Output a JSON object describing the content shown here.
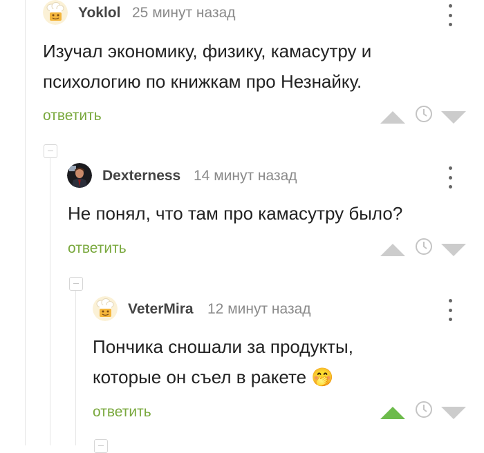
{
  "comments": [
    {
      "author": "Yoklol",
      "time": "25 минут назад",
      "text_lines": [
        "Изучал экономику, физику, камасутру и",
        "психологию по книжкам про Незнайку."
      ],
      "reply_label": "ответить"
    },
    {
      "author": "Dexterness",
      "time": "14 минут назад",
      "text_lines": [
        "Не понял, что там про камасутру было?"
      ],
      "reply_label": "ответить"
    },
    {
      "author": "VeterMira",
      "time": "12 минут назад",
      "text_lines": [
        "Пончика сношали за продукты,",
        "которые он съел в ракете"
      ],
      "reply_label": "ответить",
      "emoji": "🤭"
    }
  ],
  "colors": {
    "reply_green": "#79a83d",
    "vote_gray": "#cccccc",
    "vote_up_active": "#6dbb4c"
  },
  "icons": [
    "chef-avatar",
    "kebab-menu-icon",
    "upvote-icon",
    "clock-icon",
    "downvote-icon",
    "collapse-icon"
  ]
}
